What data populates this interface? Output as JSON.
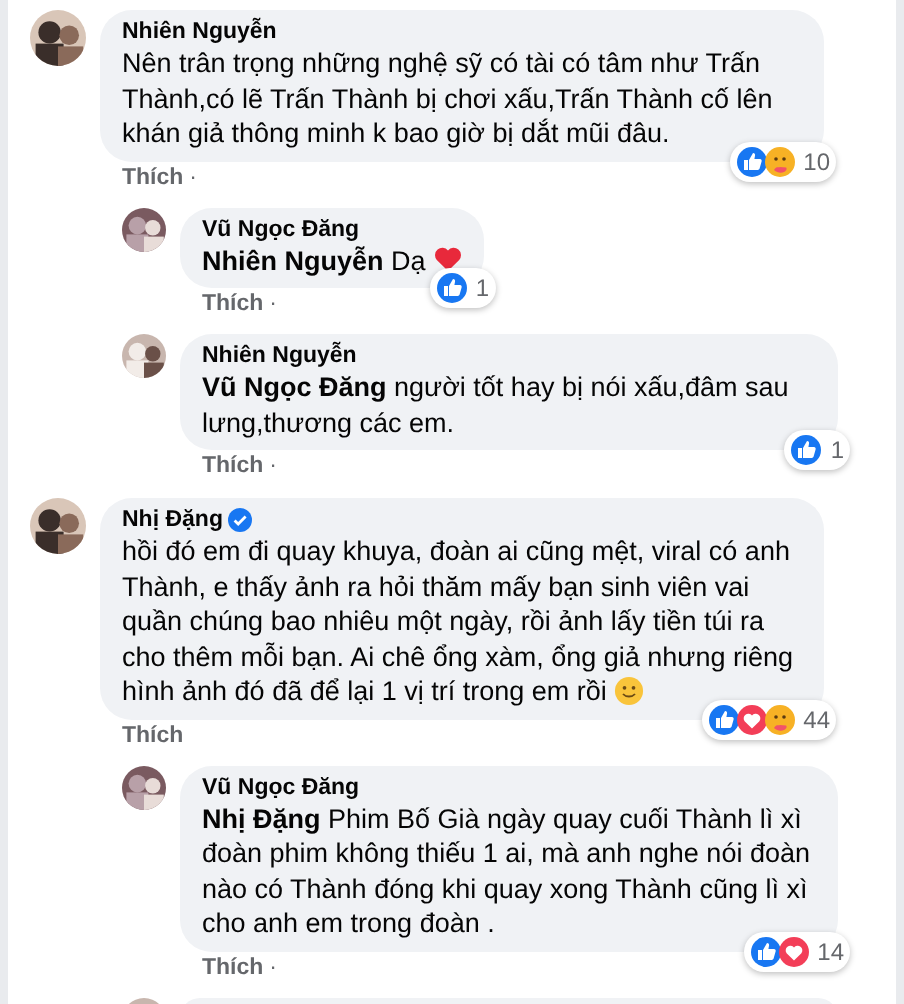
{
  "comments": [
    {
      "author": "Nhiên Nguyễn",
      "verified": false,
      "text": "Nên trân trọng những nghệ sỹ có tài có tâm như Trấn Thành,có lẽ Trấn Thành bị chơi xấu,Trấn Thành cố lên khán giả thông minh k bao giờ bị dắt mũi đâu.",
      "reactions": [
        {
          "kind": "like"
        },
        {
          "kind": "care"
        }
      ],
      "count": "10",
      "action": "Thích",
      "separator": "·",
      "replies": [
        {
          "kind": "reply",
          "author": "Vũ Ngọc Đăng",
          "text": "**Nhiên Nguyễn** Dạ",
          "trailing_emoji": {
            "kind": "heart"
          },
          "reactions": [
            {
              "kind": "like"
            }
          ],
          "count": "1",
          "action": "Thích",
          "separator": "·"
        },
        {
          "kind": "reply",
          "author": "Nhiên Nguyễn",
          "text": "**Vũ Ngọc Đăng** người tốt hay bị nói xấu,đâm sau lưng,thương các em.",
          "reactions": [
            {
              "kind": "like"
            }
          ],
          "count": "1",
          "action": "Thích",
          "separator": "·"
        }
      ]
    },
    {
      "author": "Nhị Đặng",
      "verified": true,
      "text": "hồi đó em đi quay khuya, đoàn ai cũng mệt, viral có anh Thành, e thấy ảnh ra hỏi thăm mấy bạn sinh viên vai quần chúng bao nhiêu một ngày, rồi ảnh lấy tiền túi ra cho thêm mỗi bạn. Ai chê ổng xàm, ổng giả nhưng riêng hình ảnh đó đã để lại 1 vị trí trong em rồi",
      "trailing_emoji": {
        "kind": "smile"
      },
      "reactions": [
        {
          "kind": "like"
        },
        {
          "kind": "love"
        },
        {
          "kind": "care"
        }
      ],
      "count": "44",
      "action": "Thích",
      "replies": [
        {
          "kind": "reply",
          "author": "Vũ Ngọc Đăng",
          "text": "**Nhị Đặng** Phim Bố Già ngày quay cuối Thành lì xì đoàn phim không thiếu 1 ai, mà anh nghe nói đoàn nào có Thành đóng khi quay xong Thành cũng lì xì cho anh em trong đoàn .",
          "reactions": [
            {
              "kind": "like"
            },
            {
              "kind": "love"
            }
          ],
          "count": "14",
          "action": "Thích",
          "separator": "·"
        },
        {
          "kind": "cut-off"
        }
      ]
    }
  ]
}
